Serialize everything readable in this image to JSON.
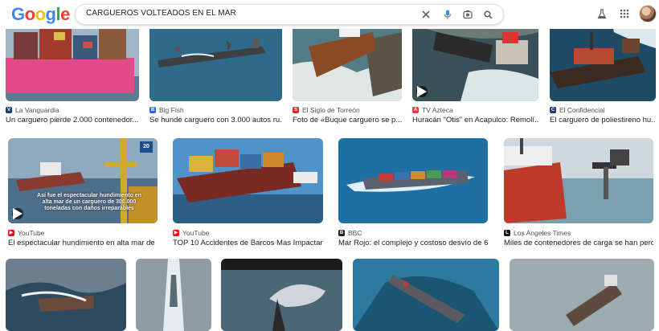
{
  "header": {
    "logo_letters": [
      {
        "ch": "G",
        "color": "#4285F4"
      },
      {
        "ch": "o",
        "color": "#EA4335"
      },
      {
        "ch": "o",
        "color": "#FBBC05"
      },
      {
        "ch": "g",
        "color": "#4285F4"
      },
      {
        "ch": "l",
        "color": "#34A853"
      },
      {
        "ch": "e",
        "color": "#EA4335"
      }
    ],
    "search_query": "CARGUEROS VOLTEADOS EN EL MAR",
    "icons": [
      "close-icon",
      "microphone-icon",
      "lens-icon",
      "search-icon",
      "labs-icon",
      "apps-icon"
    ]
  },
  "results": {
    "row1": [
      {
        "source": "La Vanguardia",
        "favicon_color": "#1a3f7a",
        "favicon_char": "V",
        "title": "Un carguero pierde 2.000 contenedor..."
      },
      {
        "source": "Big Fish",
        "favicon_color": "#2d6bd6",
        "favicon_char": "B",
        "title": "Se hunde carguero con 3.000 autos ru..."
      },
      {
        "source": "El Siglo de Torreón",
        "favicon_color": "#d32f2f",
        "favicon_char": "S",
        "title": "Foto de «Buque carguero se p..."
      },
      {
        "source": "TV Azteca",
        "favicon_color": "#e53935",
        "favicon_char": "A",
        "title": "Huracán \"Otis\" en Acapulco: Remolí..."
      },
      {
        "source": "El Confidencial",
        "favicon_color": "#1c3d6e",
        "favicon_char": "C",
        "title": "El carguero de poliestireno hu..."
      }
    ],
    "row2": [
      {
        "source": "YouTube",
        "favicon_color": "#ff0000",
        "favicon_char": "▶",
        "title": "El espectacular hundimiento en alta mar de ...",
        "overlay": "Así fue el espectacular hundimiento en alta mar de un carguero de 300.000 toneladas con daños irreparables",
        "badge": "20"
      },
      {
        "source": "YouTube",
        "favicon_color": "#ff0000",
        "favicon_char": "▶",
        "title": "TOP 10 Accidentes de Barcos Mas Impactant..."
      },
      {
        "source": "BBC",
        "favicon_color": "#222222",
        "favicon_char": "B",
        "title": "Mar Rojo: el complejo y costoso desvío de 6..."
      },
      {
        "source": "Los Angeles Times",
        "favicon_color": "#111111",
        "favicon_char": "L",
        "title": "Miles de contenedores de carga se han perdi..."
      }
    ]
  },
  "colors": {
    "link_text": "#202124",
    "source_text": "#4d5156",
    "search_border": "#dfe1e5"
  }
}
